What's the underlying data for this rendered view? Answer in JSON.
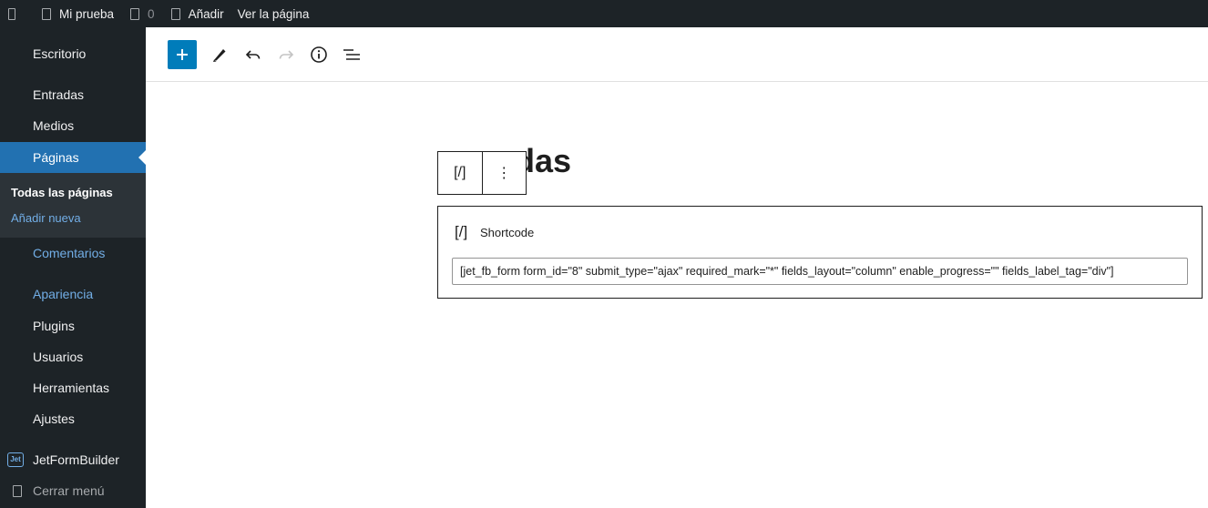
{
  "adminbar": {
    "site_name": "Mi prueba",
    "comments_count": "0",
    "new_label": "Añadir",
    "view_page": "Ver la página"
  },
  "sidebar": {
    "items": [
      {
        "label": "Escritorio"
      },
      {
        "label": "Entradas"
      },
      {
        "label": "Medios"
      },
      {
        "label": "Páginas"
      },
      {
        "label": "Comentarios"
      },
      {
        "label": "Apariencia"
      },
      {
        "label": "Plugins"
      },
      {
        "label": "Usuarios"
      },
      {
        "label": "Herramientas"
      },
      {
        "label": "Ajustes"
      },
      {
        "label": "JetFormBuilder"
      }
    ],
    "active_item": "Páginas",
    "submenu": [
      {
        "label": "Todas las páginas"
      },
      {
        "label": "Añadir nueva"
      }
    ],
    "collapse_label": "Cerrar menú",
    "jet_icon_text": "Jet"
  },
  "editor": {
    "title_visible": "das",
    "block_toolbar_icon": "[/]",
    "block_options_icon": "⋮",
    "shortcode": {
      "icon": "[/]",
      "label": "Shortcode",
      "value": "[jet_fb_form form_id=\"8\" submit_type=\"ajax\" required_mark=\"*\" fields_layout=\"column\" enable_progress=\"\" fields_label_tag=\"div\"]"
    }
  },
  "colors": {
    "admin_bg": "#1d2327",
    "accent": "#2271b1",
    "primary_button": "#007cba",
    "link": "#72aee6"
  }
}
